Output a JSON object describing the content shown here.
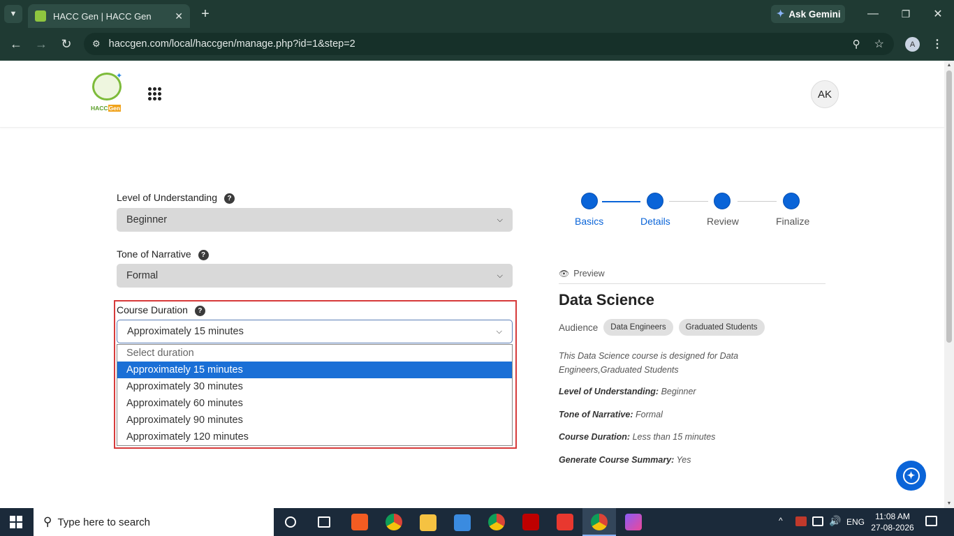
{
  "browser": {
    "tab_title": "HACC Gen | HACC Gen",
    "url": "haccgen.com/local/haccgen/manage.php?id=1&step=2",
    "gemini_label": "Ask Gemini",
    "profile_initial": "A"
  },
  "header": {
    "logo_text_a": "HACC",
    "logo_text_b": "Gen",
    "avatar": "AK"
  },
  "form": {
    "level": {
      "label": "Level of Understanding",
      "value": "Beginner"
    },
    "tone": {
      "label": "Tone of Narrative",
      "value": "Formal"
    },
    "duration": {
      "label": "Course Duration",
      "value": "Approximately 15 minutes",
      "options": [
        "Select duration",
        "Approximately 15 minutes",
        "Approximately 30 minutes",
        "Approximately 60 minutes",
        "Approximately 90 minutes",
        "Approximately 120 minutes"
      ],
      "selected_index": 1
    }
  },
  "stepper": {
    "steps": [
      "Basics",
      "Details",
      "Review",
      "Finalize"
    ],
    "current_index": 1
  },
  "preview": {
    "label": "Preview",
    "title": "Data Science",
    "audience_label": "Audience",
    "audience": [
      "Data Engineers",
      "Graduated Students"
    ],
    "description": "This Data Science course is designed for Data Engineers,Graduated Students",
    "lines": [
      {
        "key": "Level of Understanding:",
        "value": "Beginner"
      },
      {
        "key": "Tone of Narrative:",
        "value": "Formal"
      },
      {
        "key": "Course Duration:",
        "value": "Less than 15 minutes"
      },
      {
        "key": "Generate Course Summary:",
        "value": "Yes"
      }
    ]
  },
  "taskbar": {
    "search_placeholder": "Type here to search",
    "time": "11:08 AM",
    "date": "27-08-2026",
    "lang": "ENG"
  },
  "colors": {
    "accent": "#0a64d8",
    "highlight_border": "#d63a3a",
    "chrome_bg": "#1f3a33"
  }
}
